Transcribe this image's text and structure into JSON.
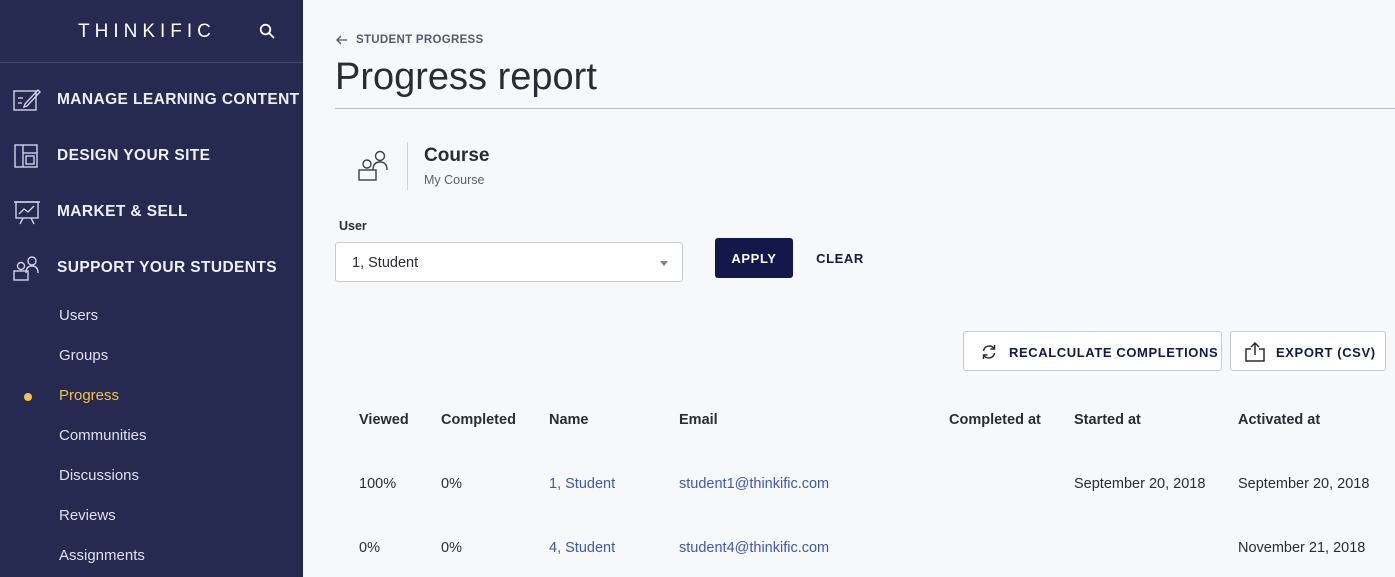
{
  "sidebar": {
    "logo": "THINKIFIC",
    "nav": [
      {
        "label": "MANAGE LEARNING CONTENT",
        "icon": "edit-icon"
      },
      {
        "label": "DESIGN YOUR SITE",
        "icon": "layout-icon"
      },
      {
        "label": "MARKET & SELL",
        "icon": "presentation-icon"
      },
      {
        "label": "SUPPORT YOUR STUDENTS",
        "icon": "students-icon"
      }
    ],
    "sub_items": [
      {
        "label": "Users"
      },
      {
        "label": "Groups"
      },
      {
        "label": "Progress",
        "active": true
      },
      {
        "label": "Communities"
      },
      {
        "label": "Discussions"
      },
      {
        "label": "Reviews"
      },
      {
        "label": "Assignments"
      }
    ]
  },
  "breadcrumb": {
    "label": "STUDENT PROGRESS"
  },
  "page_title": "Progress report",
  "course": {
    "heading": "Course",
    "name": "My Course"
  },
  "filter": {
    "user_label": "User",
    "user_value": "1, Student",
    "apply_label": "APPLY",
    "clear_label": "CLEAR"
  },
  "actions": {
    "recalculate_label": "RECALCULATE COMPLETIONS",
    "export_label": "EXPORT (CSV)"
  },
  "table": {
    "headers": [
      "Viewed",
      "Completed",
      "Name",
      "Email",
      "Completed at",
      "Started at",
      "Activated at"
    ],
    "rows": [
      {
        "viewed": "100%",
        "completed": "0%",
        "name": "1, Student",
        "email": "student1@thinkific.com",
        "completed_at": "",
        "started_at": "September 20, 2018",
        "activated_at": "September 20, 2018"
      },
      {
        "viewed": "0%",
        "completed": "0%",
        "name": "4, Student",
        "email": "student4@thinkific.com",
        "completed_at": "",
        "started_at": "",
        "activated_at": "November 21, 2018"
      }
    ]
  },
  "colors": {
    "sidebar_bg": "#262950",
    "active": "#f5c24b",
    "primary_button": "#14174a",
    "link": "#3d5aa6"
  }
}
